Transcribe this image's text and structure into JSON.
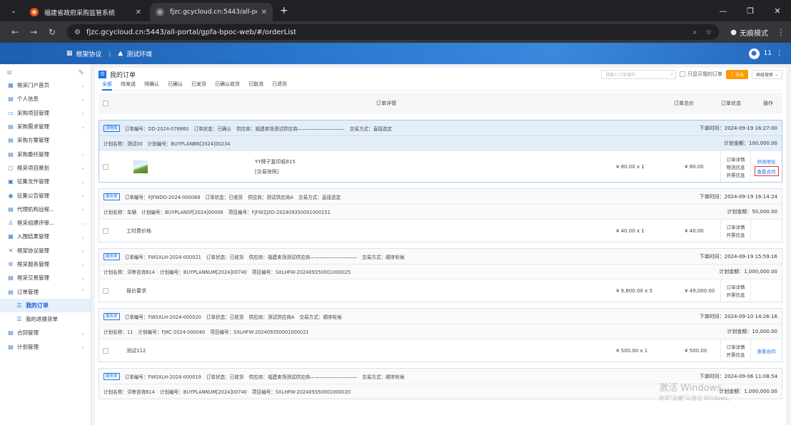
{
  "browser": {
    "tabs": [
      {
        "title": "福建省政府采购监管系统"
      },
      {
        "title": "fjzc.gcycloud.cn:5443/all-por"
      }
    ],
    "url": "fjzc.gcycloud.cn:5443/all-portal/gpfa-bpoc-web/#/orderList",
    "incognito_label": "无痕模式"
  },
  "appbar": {
    "items": [
      "框架协议",
      "测试环境"
    ],
    "user_label": "11"
  },
  "sidebar": {
    "items": [
      {
        "label": "框采门户首页",
        "icon": "grid-icon"
      },
      {
        "label": "个人信息",
        "icon": "id-card-icon"
      },
      {
        "label": "采购项目管理",
        "icon": "folder-icon"
      },
      {
        "label": "采购需求管理",
        "icon": "doc-icon"
      },
      {
        "label": "采购方案管理",
        "icon": "doc-icon"
      },
      {
        "label": "采购委托管理",
        "icon": "doc-icon"
      },
      {
        "label": "框采项目策划",
        "icon": "box-icon"
      },
      {
        "label": "征集文件管理",
        "icon": "file-icon"
      },
      {
        "label": "征集公告管理",
        "icon": "bell-icon"
      },
      {
        "label": "代理机构远程...",
        "icon": "doc-icon"
      },
      {
        "label": "框采组建评审...",
        "icon": "user-icon"
      },
      {
        "label": "入围结果管理",
        "icon": "grid-icon"
      },
      {
        "label": "框架协议管理",
        "icon": "x-icon"
      },
      {
        "label": "框采服务管理",
        "icon": "gear-icon"
      },
      {
        "label": "框采交易管理",
        "icon": "doc-icon"
      },
      {
        "label": "订单管理",
        "icon": "doc-icon"
      },
      {
        "label": "我的订单",
        "icon": "order-icon"
      },
      {
        "label": "我的退换货单",
        "icon": "order-icon"
      },
      {
        "label": "合同管理",
        "icon": "doc-icon"
      },
      {
        "label": "计划管理",
        "icon": "doc-icon"
      }
    ]
  },
  "page": {
    "title": "我的订单",
    "search_placeholder": "请输入订单编号",
    "only_mine_label": "只显示我的订单",
    "export_label": "导出",
    "advanced_search_label": "高级搜索",
    "filters": [
      "全部",
      "待发送",
      "待确认",
      "已确认",
      "已发货",
      "已确认收货",
      "已取消",
      "已退货"
    ],
    "table_headers": [
      "订单详情",
      "订单总价",
      "订单状态",
      "操作"
    ]
  },
  "orders": [
    {
      "badge": "货物类",
      "line1": [
        "订单编号：DD-2024-076660",
        "订单状态：已确认",
        "供应商：福建卖场测试供应商——————————",
        "交易方式：直接选定"
      ],
      "order_time": "下单时间：2024-09-19 16:27:00",
      "line2": [
        "计划名称：测试00",
        "计划编号：BUYPLANBN[2024]00234"
      ],
      "plan_amount": "计划金额：100,000.00",
      "item_name": "YY牌子复印纸815",
      "item_tag": "[交易快照]",
      "unit_price": "¥ 80.00 x 1",
      "total": "¥ 80.00",
      "status": [
        "订单详情",
        "物流信息",
        "开票信息"
      ],
      "actions": [
        "修改地址",
        "查看合同"
      ]
    },
    {
      "badge": "服务类",
      "line1": [
        "订单编号：FJFWDD-2024-000068",
        "订单状态：已收货",
        "供应商：测试供应商A",
        "交易方式：直接选定"
      ],
      "order_time": "下单时间：2024-09-19 16:14:24",
      "line2": [
        "计划名称：车辆",
        "计划编号：BUYPLANSP[2024]00006",
        "项目编号：FJFWZJXD-202409350001000151"
      ],
      "plan_amount": "计划金额：50,000.00",
      "item_name": "工时费价格",
      "unit_price": "¥ 40.00 x 1",
      "total": "¥ 40.00",
      "status": [
        "订单详情",
        "开票信息"
      ],
      "actions": []
    },
    {
      "badge": "服务类",
      "line1": [
        "订单编号：FWSXLH-2024-000021",
        "订单状态：已收货",
        "供应商：福建卖场测试供应商——————————",
        "交易方式：顺序轮候"
      ],
      "order_time": "下单时间：2024-09-19 15:59:16",
      "line2": [
        "计划名称：评审咨询614",
        "计划编号：BUYPLANNUM[2024]00740",
        "项目编号：SXLHFW-202409350001000025"
      ],
      "plan_amount": "计划金额：1,000,000.00",
      "item_name": "报价要求",
      "unit_price": "¥ 9,800.00 x 5",
      "total": "¥ 49,000.00",
      "status": [
        "订单详情",
        "开票信息"
      ],
      "actions": []
    },
    {
      "badge": "服务类",
      "line1": [
        "订单编号：FWSXLH-2024-000020",
        "订单状态：已收货",
        "供应商：测试供应商A",
        "交易方式：顺序轮候"
      ],
      "order_time": "下单时间：2024-09-10 14:26:16",
      "line2": [
        "计划名称：11",
        "计划编号：FJKC-2024-000040",
        "项目编号：SXLHFW-202409350001000021"
      ],
      "plan_amount": "计划金额：10,000.00",
      "item_name": "测试112",
      "unit_price": "¥ 500.00 x 1",
      "total": "¥ 500.00",
      "status": [
        "订单详情",
        "开票信息"
      ],
      "actions": [
        "查看合同"
      ]
    },
    {
      "badge": "服务类",
      "line1": [
        "订单编号：FWSXLH-2024-000019",
        "订单状态：已收货",
        "供应商：福建卖场测试供应商——————————",
        "交易方式：顺序轮候"
      ],
      "order_time": "下单时间：2024-09-06 11:08:54",
      "line2": [
        "计划名称：评审咨询614",
        "计划编号：BUYPLANNUM[2024]00740",
        "项目编号：SXLHFW-202409350001000020"
      ],
      "plan_amount": "计划金额：1,000,000.00"
    }
  ],
  "watermark": {
    "line1": "激活 Windows",
    "line2": "转到“设置”以激活 Windows。"
  }
}
